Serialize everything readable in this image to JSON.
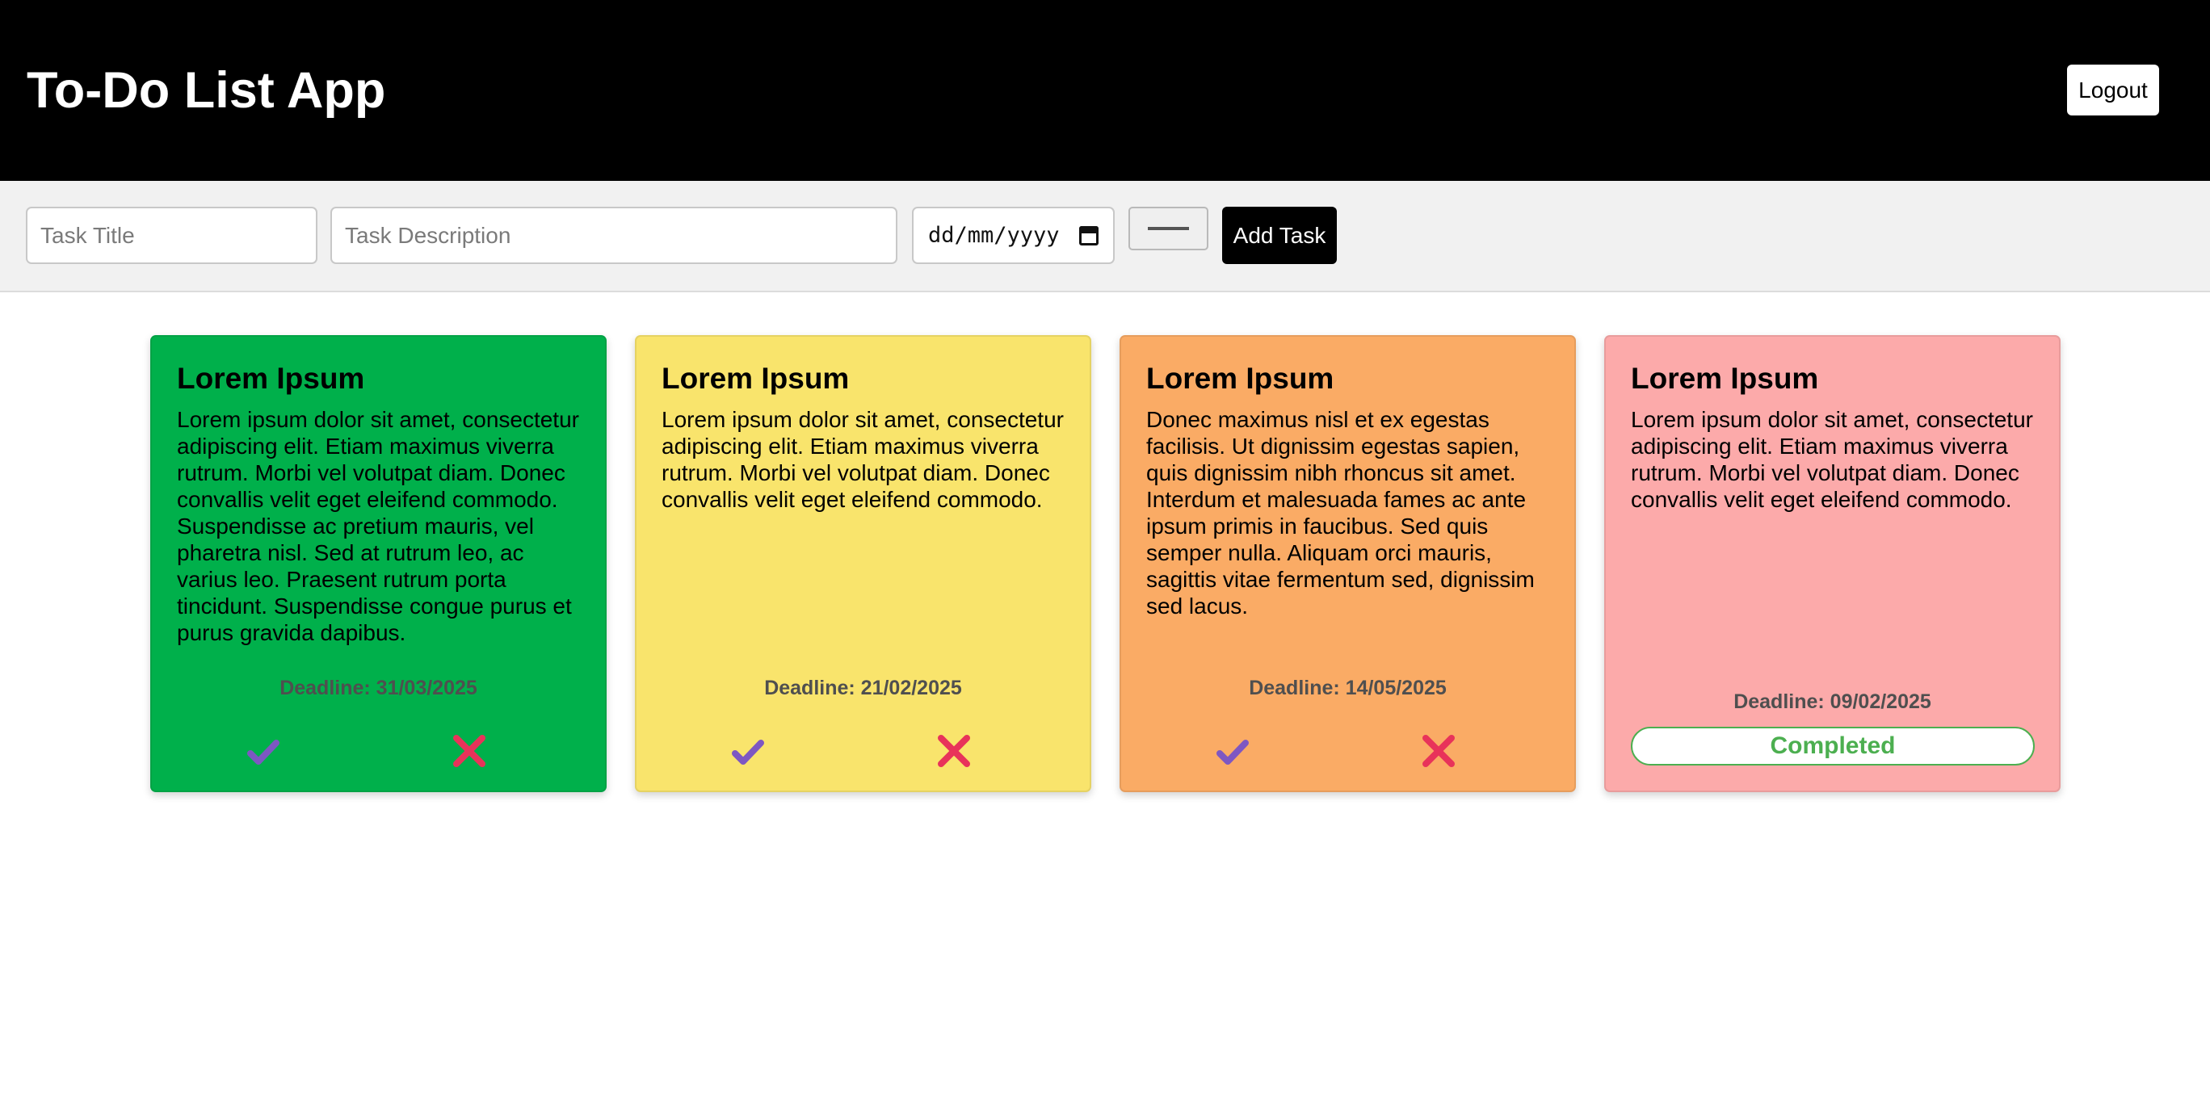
{
  "header": {
    "title": "To-Do List App",
    "logout_label": "Logout"
  },
  "form": {
    "title_placeholder": "Task Title",
    "description_placeholder": "Task Description",
    "date_placeholder": "dd/mm/yyyy",
    "add_label": "Add Task"
  },
  "icons": {
    "complete": "check-icon",
    "delete": "cross-icon",
    "calendar": "calendar-icon"
  },
  "colors": {
    "check": "#7e57c2",
    "cross": "#e8335a",
    "completed": "#4caf50"
  },
  "tasks": [
    {
      "title": "Lorem Ipsum",
      "description": "Lorem ipsum dolor sit amet, consectetur adipiscing elit. Etiam maximus viverra rutrum. Morbi vel volutpat diam. Donec convallis velit eget eleifend commodo. Suspendisse ac pretium mauris, vel pharetra nisl. Sed at rutrum leo, ac varius leo. Praesent rutrum porta tincidunt. Suspendisse congue purus et purus gravida dapibus.",
      "deadline_label": "Deadline:",
      "deadline": "31/03/2025",
      "color": "#00b04b",
      "completed": false
    },
    {
      "title": "Lorem Ipsum",
      "description": "Lorem ipsum dolor sit amet, consectetur adipiscing elit. Etiam maximus viverra rutrum. Morbi vel volutpat diam. Donec convallis velit eget eleifend commodo.",
      "deadline_label": "Deadline:",
      "deadline": "21/02/2025",
      "color": "#f9e46c",
      "completed": false
    },
    {
      "title": "Lorem Ipsum",
      "description": "Donec maximus nisl et ex egestas facilisis. Ut dignissim egestas sapien, quis dignissim nibh rhoncus sit amet. Interdum et malesuada fames ac ante ipsum primis in faucibus. Sed quis semper nulla. Aliquam orci mauris, sagittis vitae fermentum sed, dignissim sed lacus.",
      "deadline_label": "Deadline:",
      "deadline": "14/05/2025",
      "color": "#faab65",
      "completed": false
    },
    {
      "title": "Lorem Ipsum",
      "description": "Lorem ipsum dolor sit amet, consectetur adipiscing elit. Etiam maximus viverra rutrum. Morbi vel volutpat diam. Donec convallis velit eget eleifend commodo.",
      "deadline_label": "Deadline:",
      "deadline": "09/02/2025",
      "color": "#fcaaaa",
      "completed": true,
      "completed_label": "Completed"
    }
  ]
}
